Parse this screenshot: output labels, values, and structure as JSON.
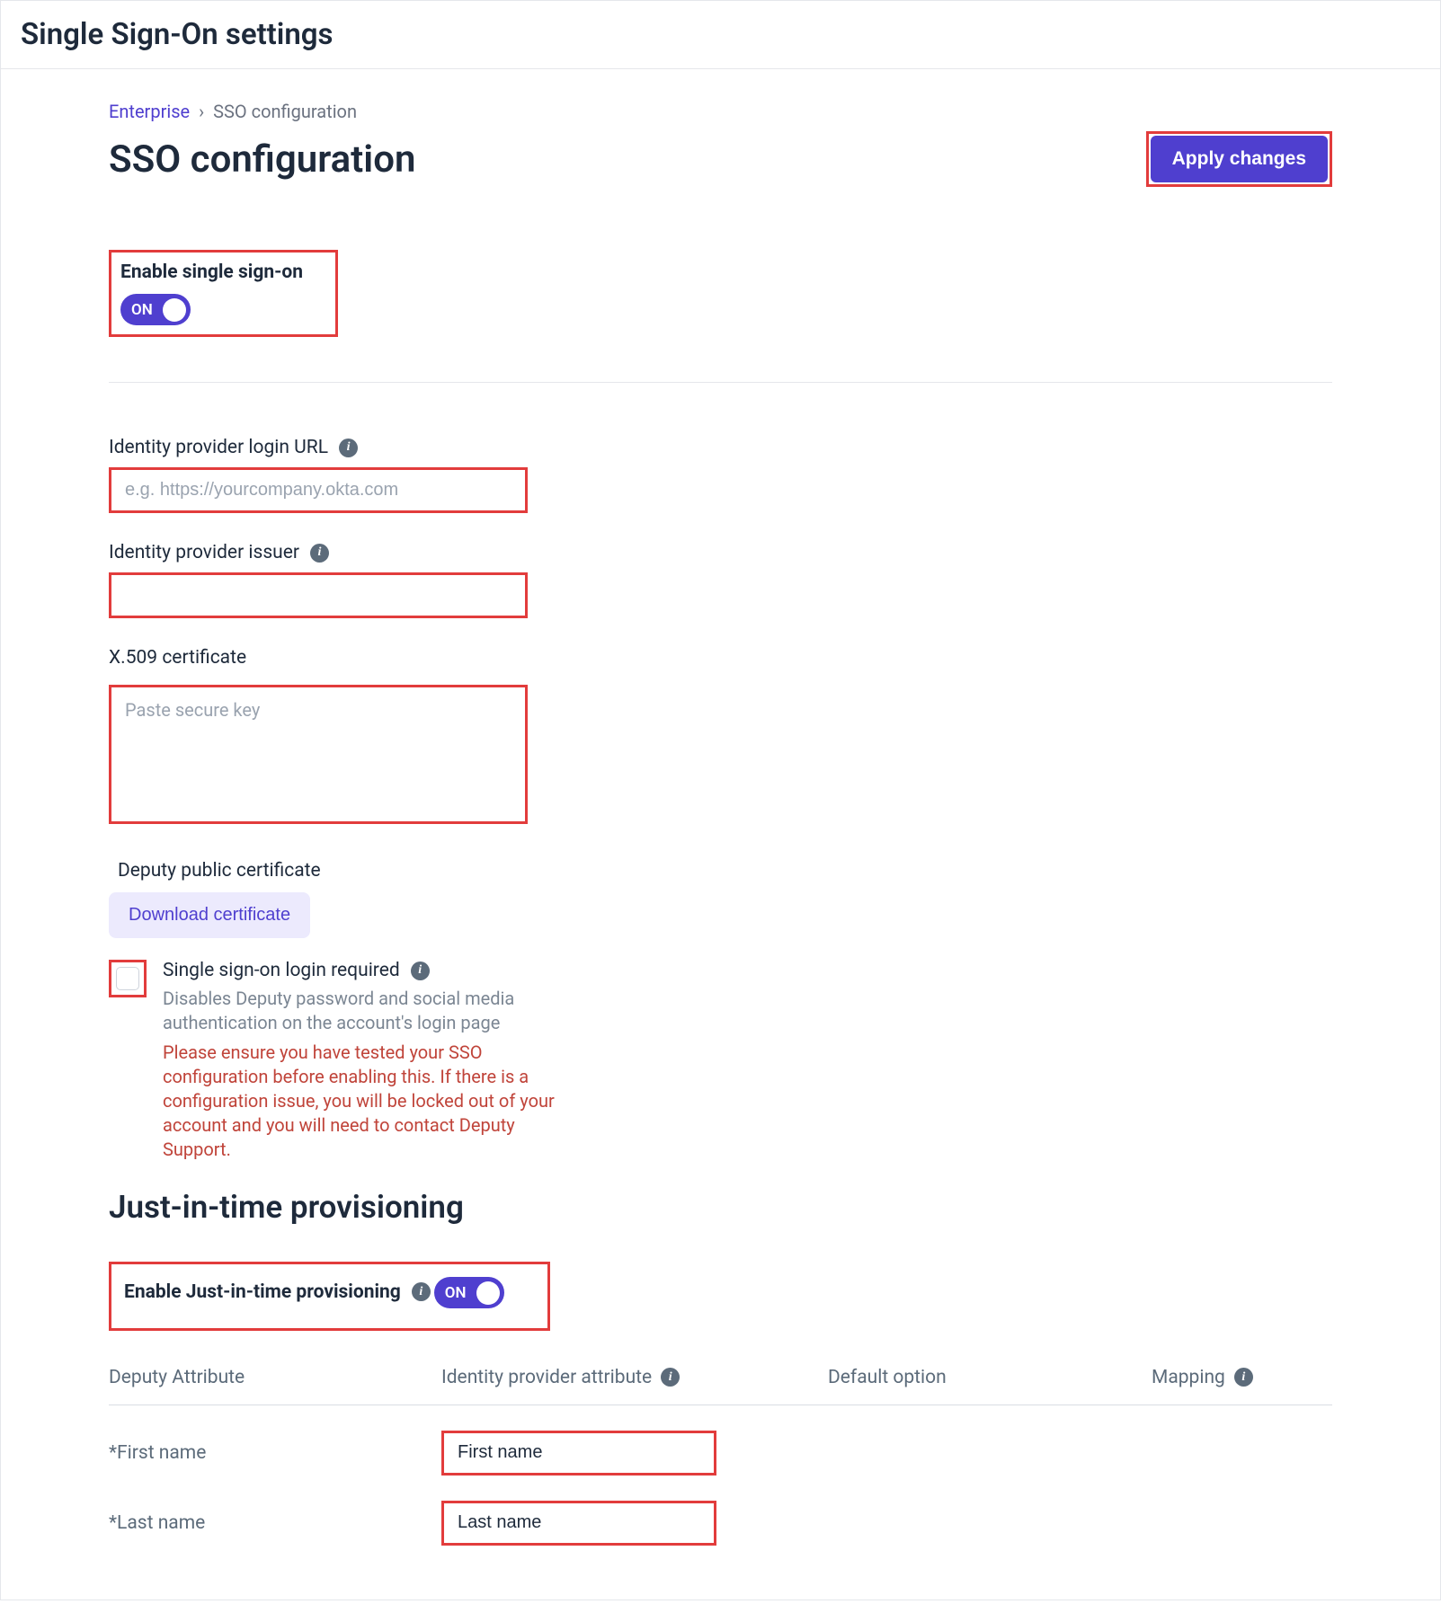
{
  "title": "Single Sign-On settings",
  "breadcrumb": {
    "root": "Enterprise",
    "current": "SSO configuration"
  },
  "page_title": "SSO configuration",
  "apply_label": "Apply changes",
  "enable_sso": {
    "label": "Enable single sign-on",
    "state": "ON"
  },
  "idp_login": {
    "label": "Identity provider login URL",
    "placeholder": "e.g. https://yourcompany.okta.com",
    "value": ""
  },
  "idp_issuer": {
    "label": "Identity provider issuer",
    "value": ""
  },
  "x509": {
    "label": "X.509 certificate",
    "placeholder": "Paste secure key",
    "value": ""
  },
  "deputy_cert": {
    "label": "Deputy public certificate",
    "download_label": "Download certificate"
  },
  "login_required": {
    "label": "Single sign-on login required",
    "help": "Disables Deputy password and social media authentication on the account's login page",
    "warning": "Please ensure you have tested your SSO configuration before enabling this. If there is a configuration issue, you will be locked out of your account and you will need to contact Deputy Support."
  },
  "jit": {
    "title": "Just-in-time provisioning",
    "enable_label": "Enable Just-in-time provisioning",
    "state": "ON",
    "columns": {
      "deputy_attr": "Deputy Attribute",
      "idp_attr": "Identity provider attribute",
      "default": "Default option",
      "mapping": "Mapping"
    },
    "rows": [
      {
        "name": "*First name",
        "idp_value": "First name"
      },
      {
        "name": "*Last name",
        "idp_value": "Last name"
      }
    ]
  }
}
